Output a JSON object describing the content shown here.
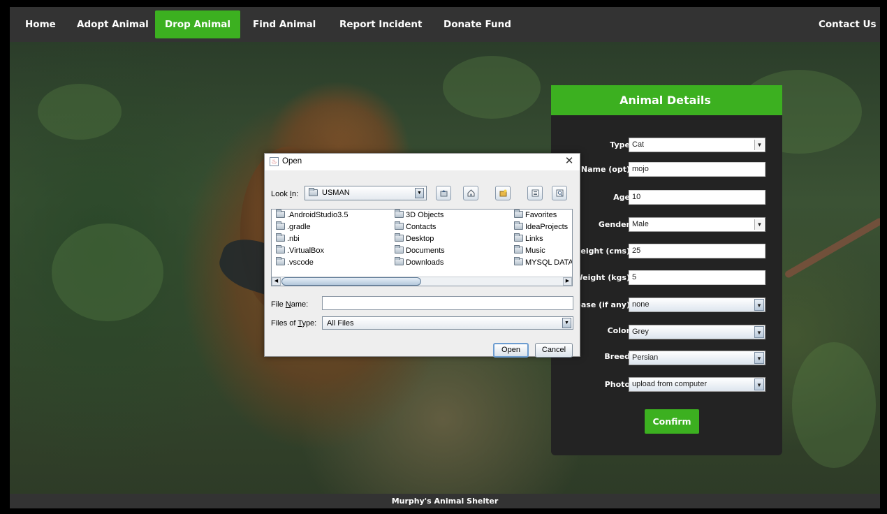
{
  "nav": {
    "home": "Home",
    "adopt": "Adopt Animal",
    "drop": "Drop Animal",
    "find": "Find Animal",
    "report": "Report Incident",
    "donate": "Donate Fund",
    "contact": "Contact Us"
  },
  "footer": {
    "text": "Murphy's Animal Shelter"
  },
  "panel": {
    "title": "Animal Details",
    "fields": {
      "type": {
        "label": "Type",
        "value": "Cat"
      },
      "name": {
        "label": "Name (opt)",
        "value": "mojo"
      },
      "age": {
        "label": "Age",
        "value": "10"
      },
      "gender": {
        "label": "Gender",
        "value": "Male"
      },
      "height": {
        "label": "Height (cms)",
        "value": "25"
      },
      "weight": {
        "label": "Weight (kgs)",
        "value": "5"
      },
      "disease": {
        "label": "Disease (if any)",
        "value": "none"
      },
      "color": {
        "label": "Color",
        "value": "Grey"
      },
      "breed": {
        "label": "Breed",
        "value": "Persian"
      },
      "photo": {
        "label": "Photo",
        "value": "upload from computer"
      }
    },
    "confirm_label": "Confirm"
  },
  "dialog": {
    "title": "Open",
    "look_in_prefix": "Look ",
    "look_in_mnemonic": "I",
    "look_in_suffix": "n:",
    "look_in_value": "USMAN",
    "files": [
      ".AndroidStudio3.5",
      ".gradle",
      ".nbi",
      ".VirtualBox",
      ".vscode",
      "3D Objects",
      "Contacts",
      "Desktop",
      "Documents",
      "Downloads",
      "Favorites",
      "IdeaProjects",
      "Links",
      "Music",
      "MYSQL DATA"
    ],
    "file_name_prefix": "File ",
    "file_name_mnemonic": "N",
    "file_name_suffix": "ame:",
    "file_name_value": "",
    "files_of_type_prefix": "Files of ",
    "files_of_type_mnemonic": "T",
    "files_of_type_suffix": "ype:",
    "files_of_type_value": "All Files",
    "open_label": "Open",
    "cancel_label": "Cancel"
  },
  "colors": {
    "accent": "#3cb020",
    "navbar": "#333333",
    "panel": "#232323"
  }
}
